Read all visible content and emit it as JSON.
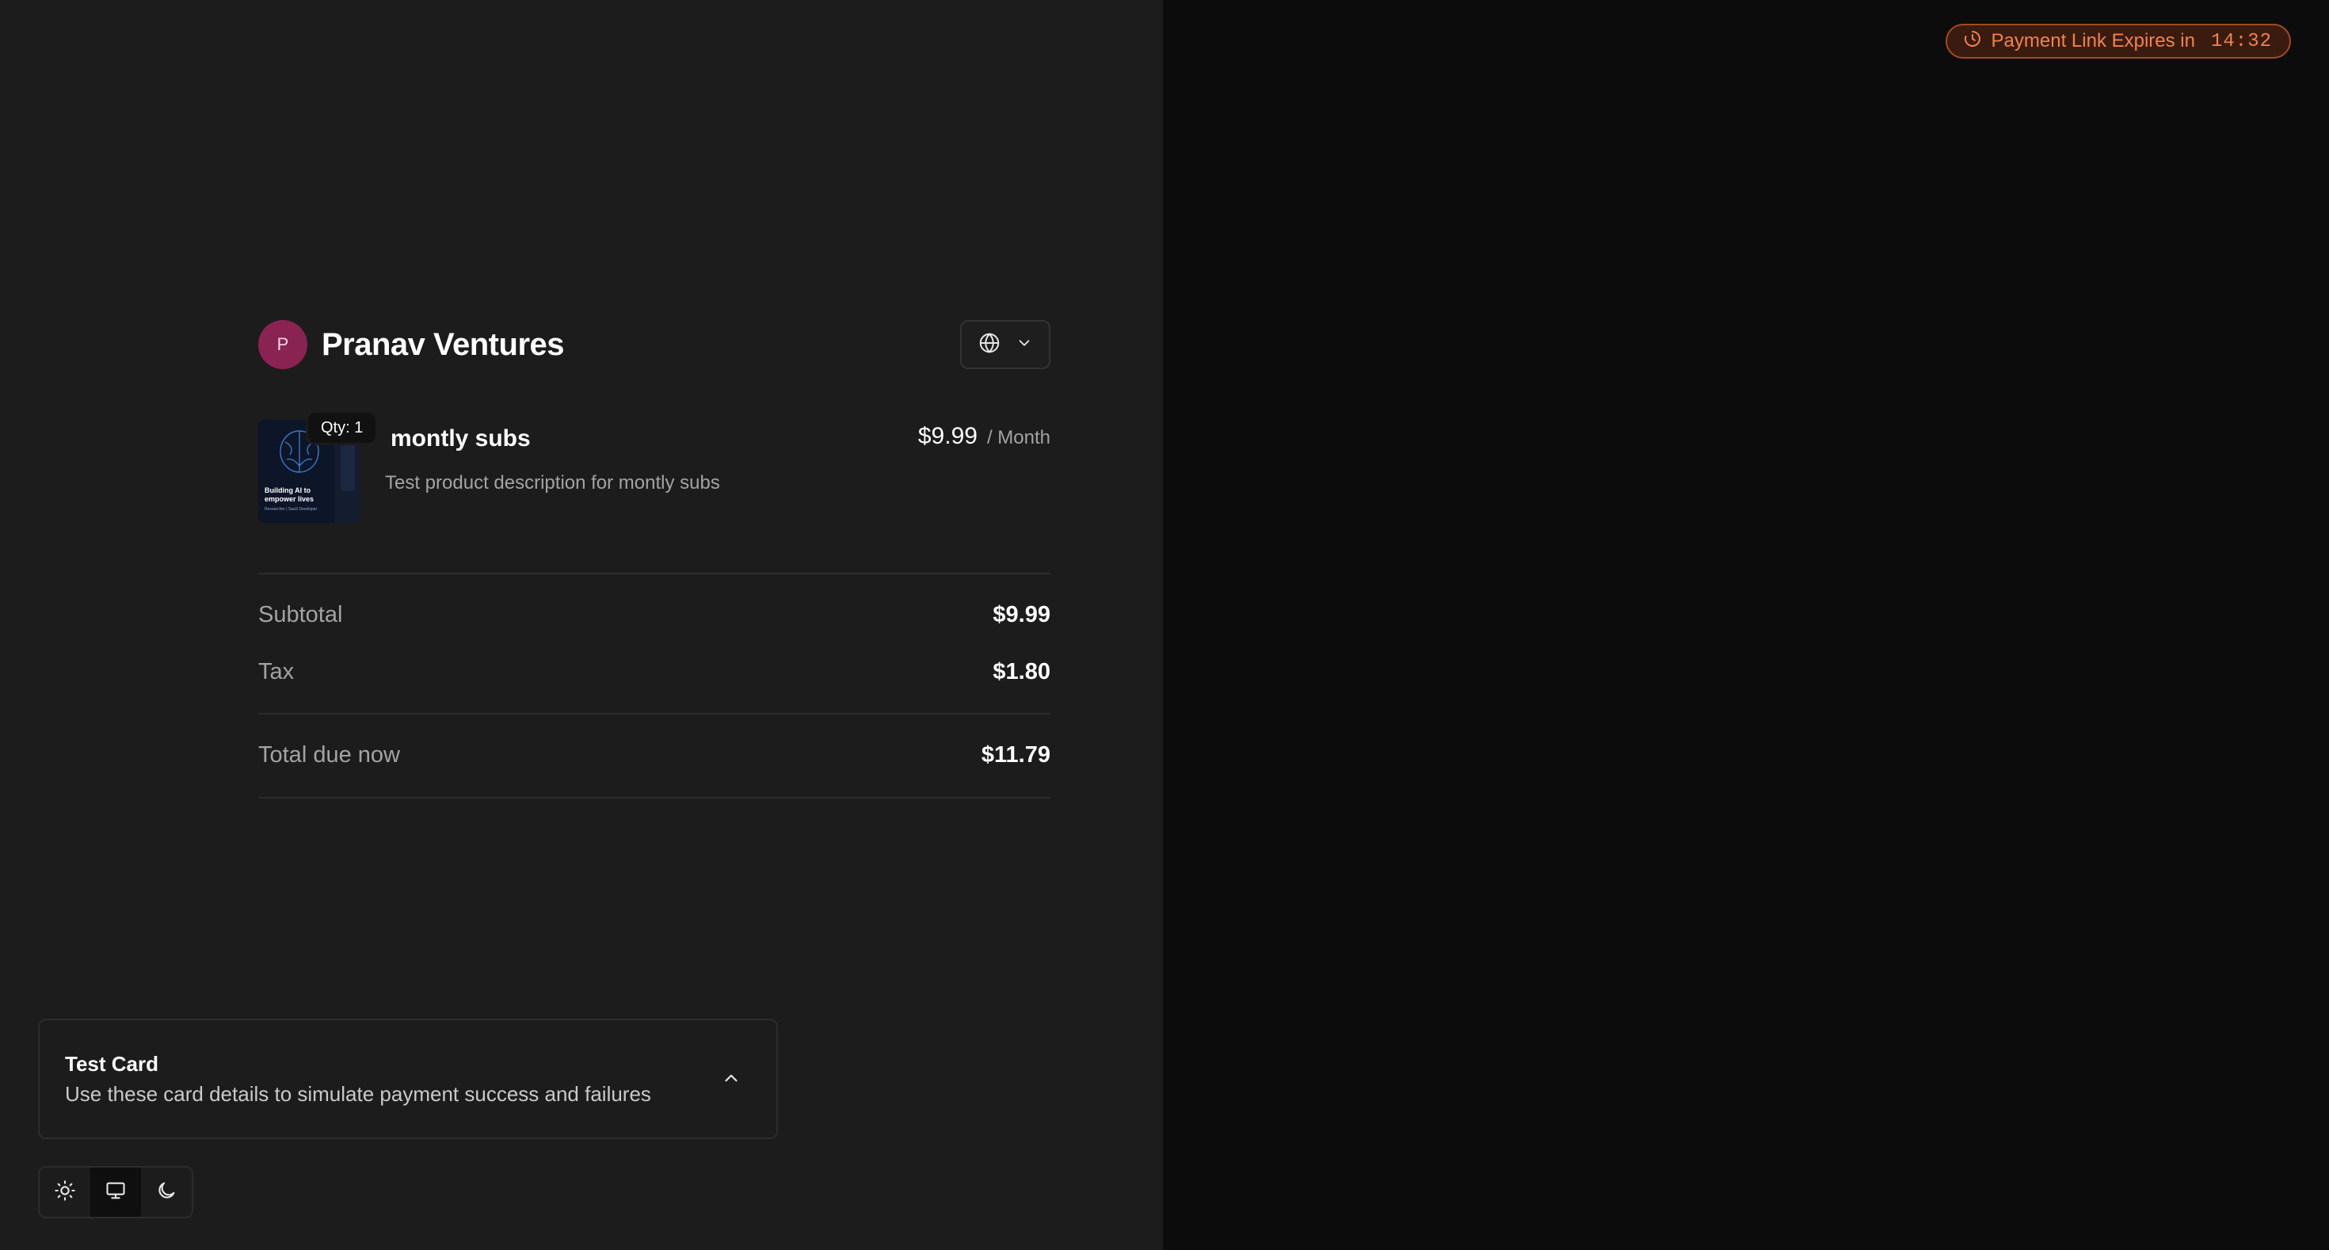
{
  "expiry": {
    "label": "Payment Link Expires in",
    "time": "14:32",
    "icon": "timer-icon",
    "color": "#f0834c"
  },
  "merchant": {
    "initial": "P",
    "name": "Pranav Ventures",
    "avatar_color": "#8b2352"
  },
  "language_selector": {
    "icon": "globe-icon"
  },
  "product": {
    "qty_label": "Qty: 1",
    "name": "montly subs",
    "description": "Test product description for montly subs",
    "price": "$9.99",
    "period": "/ Month",
    "thumbnail": {
      "line1": "Building AI to",
      "line2": "empower lives",
      "line3": "Researcher | SaaS Developer"
    }
  },
  "summary": {
    "subtotal_label": "Subtotal",
    "subtotal_value": "$9.99",
    "tax_label": "Tax",
    "tax_value": "$1.80",
    "total_label": "Total due now",
    "total_value": "$11.79"
  },
  "test_card": {
    "title": "Test Card",
    "description": "Use these card details to simulate payment success and failures",
    "toggle_icon": "chevron-up-icon"
  },
  "theme_switch": {
    "options": [
      "light",
      "system",
      "dark"
    ],
    "selected": "system"
  }
}
